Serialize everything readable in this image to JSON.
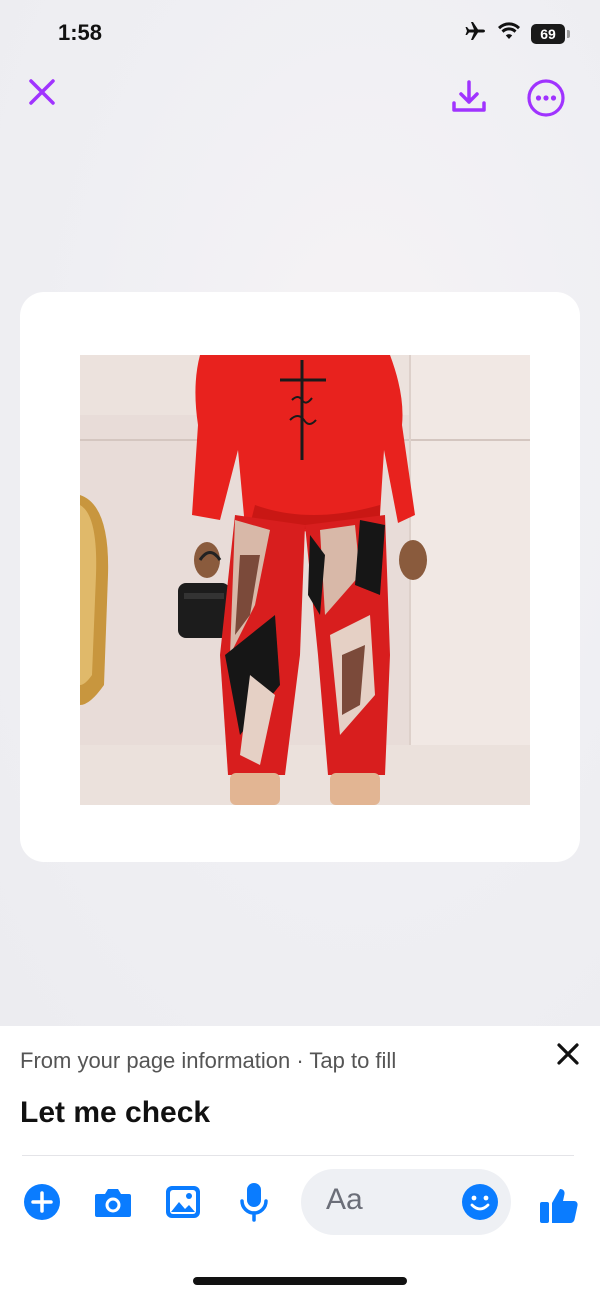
{
  "status_bar": {
    "time": "1:58",
    "battery": "69"
  },
  "icons": {
    "close": "close-icon",
    "download": "download-icon",
    "more": "more-options-icon",
    "add": "plus-circle-icon",
    "camera": "camera-icon",
    "gallery": "photo-gallery-icon",
    "mic": "microphone-icon",
    "emoji": "emoji-icon",
    "like": "thumbs-up-icon"
  },
  "colors": {
    "accent_purple": "#a033ff",
    "messenger_blue": "#0a7cff"
  },
  "suggestion": {
    "hint": "From your page information · Tap to fill",
    "text": "Let me check"
  },
  "composer": {
    "placeholder": "Aa"
  }
}
